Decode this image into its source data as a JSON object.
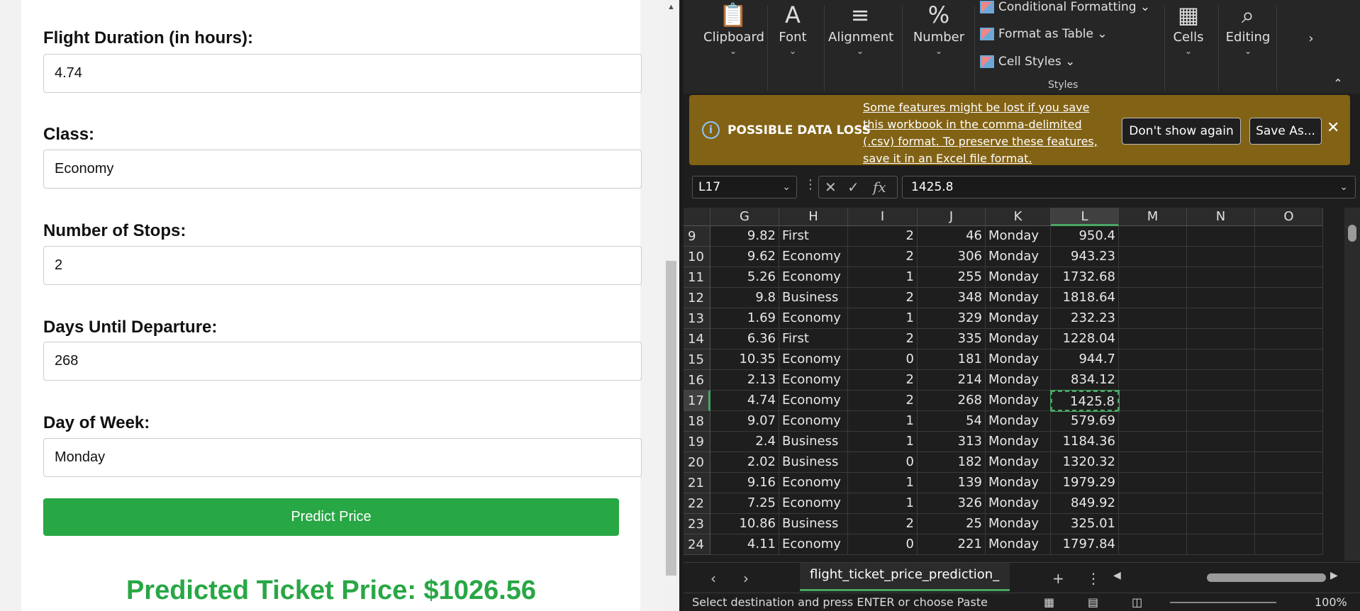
{
  "form": {
    "fields": [
      {
        "label": "Flight Duration (in hours):",
        "value": "4.74"
      },
      {
        "label": "Class:",
        "value": "Economy"
      },
      {
        "label": "Number of Stops:",
        "value": "2"
      },
      {
        "label": "Days Until Departure:",
        "value": "268"
      },
      {
        "label": "Day of Week:",
        "value": "Monday"
      }
    ],
    "button": "Predict Price",
    "prediction": "Predicted Ticket Price: $1026.56"
  },
  "ribbon": {
    "groups": [
      "Clipboard",
      "Font",
      "Alignment",
      "Number",
      "Cells",
      "Editing"
    ],
    "styles": {
      "conditional": "Conditional Formatting",
      "format_table": "Format as Table",
      "cell_styles": "Cell Styles",
      "caption": "Styles"
    }
  },
  "banner": {
    "title": "POSSIBLE DATA LOSS",
    "message": "Some features might be lost if you save this workbook in the comma-delimited (.csv) format. To preserve these features, save it in an Excel file format.",
    "dont_show": "Don't show again",
    "save_as": "Save As..."
  },
  "formula": {
    "cell_ref": "L17",
    "value": "1425.8"
  },
  "sheet": {
    "columns": [
      "G",
      "H",
      "I",
      "J",
      "K",
      "L",
      "M",
      "N",
      "O"
    ],
    "selected_column": "L",
    "selected_row": "17",
    "rows": [
      {
        "n": "9",
        "g": "9.82",
        "h": "First",
        "i": "2",
        "j": "46",
        "k": "Monday",
        "l": "950.4"
      },
      {
        "n": "10",
        "g": "9.62",
        "h": "Economy",
        "i": "2",
        "j": "306",
        "k": "Monday",
        "l": "943.23"
      },
      {
        "n": "11",
        "g": "5.26",
        "h": "Economy",
        "i": "1",
        "j": "255",
        "k": "Monday",
        "l": "1732.68"
      },
      {
        "n": "12",
        "g": "9.8",
        "h": "Business",
        "i": "2",
        "j": "348",
        "k": "Monday",
        "l": "1818.64"
      },
      {
        "n": "13",
        "g": "1.69",
        "h": "Economy",
        "i": "1",
        "j": "329",
        "k": "Monday",
        "l": "232.23"
      },
      {
        "n": "14",
        "g": "6.36",
        "h": "First",
        "i": "2",
        "j": "335",
        "k": "Monday",
        "l": "1228.04"
      },
      {
        "n": "15",
        "g": "10.35",
        "h": "Economy",
        "i": "0",
        "j": "181",
        "k": "Monday",
        "l": "944.7"
      },
      {
        "n": "16",
        "g": "2.13",
        "h": "Economy",
        "i": "2",
        "j": "214",
        "k": "Monday",
        "l": "834.12"
      },
      {
        "n": "17",
        "g": "4.74",
        "h": "Economy",
        "i": "2",
        "j": "268",
        "k": "Monday",
        "l": "1425.8"
      },
      {
        "n": "18",
        "g": "9.07",
        "h": "Economy",
        "i": "1",
        "j": "54",
        "k": "Monday",
        "l": "579.69"
      },
      {
        "n": "19",
        "g": "2.4",
        "h": "Business",
        "i": "1",
        "j": "313",
        "k": "Monday",
        "l": "1184.36"
      },
      {
        "n": "20",
        "g": "2.02",
        "h": "Business",
        "i": "0",
        "j": "182",
        "k": "Monday",
        "l": "1320.32"
      },
      {
        "n": "21",
        "g": "9.16",
        "h": "Economy",
        "i": "1",
        "j": "139",
        "k": "Monday",
        "l": "1979.29"
      },
      {
        "n": "22",
        "g": "7.25",
        "h": "Economy",
        "i": "1",
        "j": "326",
        "k": "Monday",
        "l": "849.92"
      },
      {
        "n": "23",
        "g": "10.86",
        "h": "Business",
        "i": "2",
        "j": "25",
        "k": "Monday",
        "l": "325.01"
      },
      {
        "n": "24",
        "g": "4.11",
        "h": "Economy",
        "i": "0",
        "j": "221",
        "k": "Monday",
        "l": "1797.84"
      }
    ],
    "tab_name": "flight_ticket_price_prediction_",
    "status": "Select destination and press ENTER or choose Paste",
    "zoom": "100%"
  }
}
